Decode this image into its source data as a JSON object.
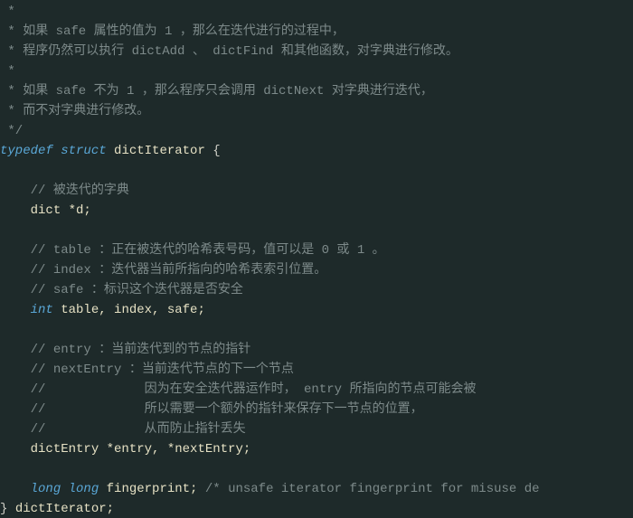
{
  "code": {
    "c1": " *",
    "c2": " * 如果 safe 属性的值为 1 ，那么在迭代进行的过程中，",
    "c3": " * 程序仍然可以执行 dictAdd 、 dictFind 和其他函数，对字典进行修改。",
    "c4": " *",
    "c5": " * 如果 safe 不为 1 ，那么程序只会调用 dictNext 对字典进行迭代，",
    "c6": " * 而不对字典进行修改。",
    "c7": " */",
    "kw_typedef": "typedef",
    "kw_struct": "struct",
    "id_dictIterator": "dictIterator",
    "brace_open": "{",
    "cc1": "// 被迭代的字典",
    "l_dictd_type": "dict ",
    "l_dictd_rest": "*d;",
    "cc2": "// table ：正在被迭代的哈希表号码，值可以是 0 或 1 。",
    "cc3": "// index ：迭代器当前所指向的哈希表索引位置。",
    "cc4": "// safe ：标识这个迭代器是否安全",
    "kw_int": "int",
    "l_int_rest": " table, index, safe;",
    "cc5": "// entry ：当前迭代到的节点的指针",
    "cc6": "// nextEntry ：当前迭代节点的下一个节点",
    "cc7": "//             因为在安全迭代器运作时， entry 所指向的节点可能会被",
    "cc8": "//             所以需要一个额外的指针来保存下一节点的位置，",
    "cc9": "//             从而防止指针丢失",
    "l_entry_type": "dictEntry ",
    "l_entry_rest": "*entry, *nextEntry;",
    "kw_long1": "long",
    "kw_long2": "long",
    "l_fp_id": " fingerprint; ",
    "l_fp_cmt": "/* unsafe iterator fingerprint for misuse de",
    "brace_close": "} ",
    "id_close": "dictIterator;"
  }
}
